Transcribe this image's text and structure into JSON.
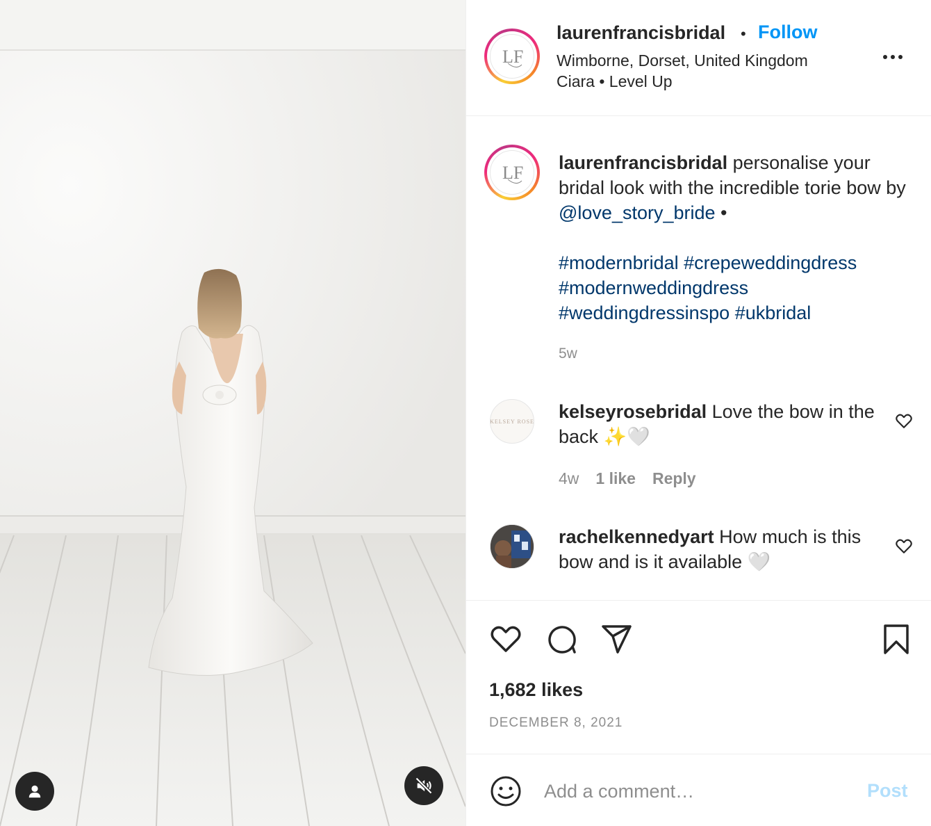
{
  "post": {
    "username": "laurenfrancisbridal",
    "follow_label": "Follow",
    "separator": "•",
    "location": "Wimborne, Dorset, United Kingdom",
    "audio": "Ciara • Level Up",
    "avatar_monogram": "LF"
  },
  "caption": {
    "username": "laurenfrancisbridal",
    "text_before_mention": " personalise your bridal look with the incredible torie bow by ",
    "mention": "@love_story_bride",
    "text_after_mention": " •",
    "hashtags": [
      "#modernbridal",
      "#crepeweddingdress",
      "#modernweddingdress",
      "#weddingdressinspo",
      "#ukbridal"
    ],
    "time": "5w"
  },
  "comments": [
    {
      "username": "kelseyrosebridal",
      "text": " Love the bow in the back ✨🤍",
      "avatar_text": "KELSEY ROSE",
      "time": "4w",
      "likes": "1 like",
      "reply_label": "Reply"
    },
    {
      "username": "rachelkennedyart",
      "text": " How much is this bow and is it available 🤍"
    }
  ],
  "actions": {
    "likes": "1,682 likes",
    "date": "DECEMBER 8, 2021"
  },
  "composer": {
    "placeholder": "Add a comment…",
    "post_label": "Post"
  },
  "icons": {
    "more": "more-options-icon",
    "like": "heart-icon",
    "comment": "comment-bubble-icon",
    "share": "paper-plane-icon",
    "save": "bookmark-icon",
    "emoji": "emoji-smile-icon",
    "user": "user-tag-icon",
    "mute": "speaker-muted-icon"
  },
  "colors": {
    "accent": "#0095f6",
    "link": "#00376b",
    "secondary_text": "#8e8e8e",
    "post_disabled": "#b2dffc"
  }
}
